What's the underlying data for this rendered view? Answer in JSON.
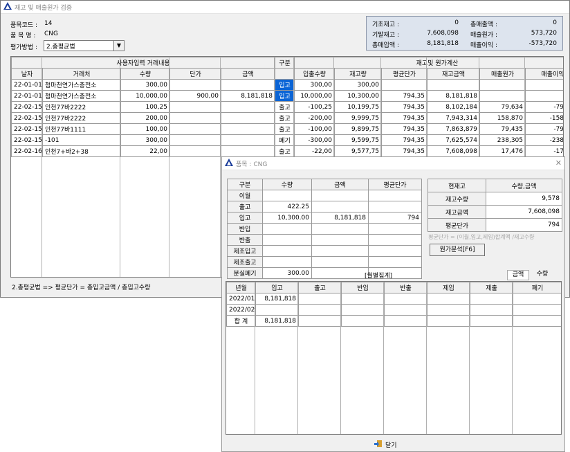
{
  "main": {
    "title": "재고 및 매출원가 검증",
    "item_code_label": "품목코드 :",
    "item_code": "14",
    "item_name_label": "품 목 명 :",
    "item_name": "CNG",
    "method_label": "평가방법 :",
    "method_value": "2.총평균법",
    "summary": {
      "base_stock_label": "기초재고 :",
      "base_stock": "0",
      "end_stock_label": "기말재고 :",
      "end_stock": "7,608,098",
      "total_in_label": "총매입액 :",
      "total_in": "8,181,818",
      "total_sales_label": "총매출액 :",
      "total_sales": "0",
      "cost_label": "매출원가 :",
      "cost": "573,720",
      "profit_label": "매출이익 :",
      "profit": "-573,720"
    },
    "group_user": "사용자입력 거래내용",
    "group_type": "구분",
    "group_calc": "재고및 원가계산",
    "columns": [
      "날자",
      "거래처",
      "수량",
      "단가",
      "금액",
      "입출수량",
      "재고량",
      "평균단가",
      "재고금액",
      "매출원가",
      "매출이익"
    ],
    "rows": [
      [
        "22-01-01",
        "첨마천연가스충전소",
        "300,00",
        "",
        "",
        "입고",
        "300,00",
        "300,00",
        "",
        "",
        "",
        ""
      ],
      [
        "22-01-01",
        "첨마천연가스충전소",
        "10,000,00",
        "900,00",
        "8,181,818",
        "입고",
        "10,000,00",
        "10,300,00",
        "794,35",
        "8,181,818",
        "",
        ""
      ],
      [
        "22-02-15",
        "인천77바2222",
        "100,25",
        "",
        "",
        "출고",
        "-100,25",
        "10,199,75",
        "794,35",
        "8,102,184",
        "79,634",
        "-79,634"
      ],
      [
        "22-02-15",
        "인천77바2222",
        "200,00",
        "",
        "",
        "출고",
        "-200,00",
        "9,999,75",
        "794,35",
        "7,943,314",
        "158,870",
        "-158,870"
      ],
      [
        "22-02-15",
        "인천77바1111",
        "100,00",
        "",
        "",
        "출고",
        "-100,00",
        "9,899,75",
        "794,35",
        "7,863,879",
        "79,435",
        "-79,435"
      ],
      [
        "22-02-15",
        "-101",
        "300,00",
        "",
        "",
        "폐기",
        "-300,00",
        "9,599,75",
        "794,35",
        "7,625,574",
        "238,305",
        "-238,305"
      ],
      [
        "22-02-16",
        "인천7+바2+38",
        "22,00",
        "",
        "",
        "출고",
        "-22,00",
        "9,577,75",
        "794,35",
        "7,608,098",
        "17,476",
        "-17,476"
      ]
    ],
    "footer_note": "2.총평균법 => 평균단가 = 총입고금액 / 총입고수량"
  },
  "dialog": {
    "title": "품목 : CNG",
    "qty_table": {
      "headers": [
        "구분",
        "수량",
        "금액",
        "평균단가"
      ],
      "rows": [
        [
          "이월",
          "",
          "",
          ""
        ],
        [
          "출고",
          "422.25",
          "",
          ""
        ],
        [
          "입고",
          "10,300.00",
          "8,181,818",
          "794"
        ],
        [
          "반입",
          "",
          "",
          ""
        ],
        [
          "반출",
          "",
          "",
          ""
        ],
        [
          "제조입고",
          "",
          "",
          ""
        ],
        [
          "제조출고",
          "",
          "",
          ""
        ],
        [
          "분실폐기",
          "300.00",
          "",
          ""
        ]
      ]
    },
    "cur_table": {
      "headers": [
        "현재고",
        "수량,금액"
      ],
      "rows": [
        [
          "재고수량",
          "9,578"
        ],
        [
          "재고금액",
          "7,608,098"
        ],
        [
          "평균단가",
          "794"
        ]
      ]
    },
    "formula_hint": "평균단가 = (이월,입고,제입)합계액 /재고수량",
    "analysis_button": "원가분석[F6]",
    "monthly_title": "[월별집계]",
    "toggle_amount": "금액",
    "toggle_qty": "수량",
    "monthly_headers": [
      "년월",
      "입고",
      "출고",
      "반입",
      "반출",
      "제입",
      "제출",
      "폐기"
    ],
    "monthly_rows": [
      [
        "2022/01",
        "8,181,818",
        "",
        "",
        "",
        "",
        "",
        ""
      ],
      [
        "2022/02",
        "",
        "",
        "",
        "",
        "",
        "",
        ""
      ],
      [
        "합 계",
        "8,181,818",
        "",
        "",
        "",
        "",
        "",
        ""
      ]
    ],
    "close_button": "닫기"
  },
  "colors": {
    "selected": "#0a64d6",
    "summary_bg": "#dde4ee"
  }
}
